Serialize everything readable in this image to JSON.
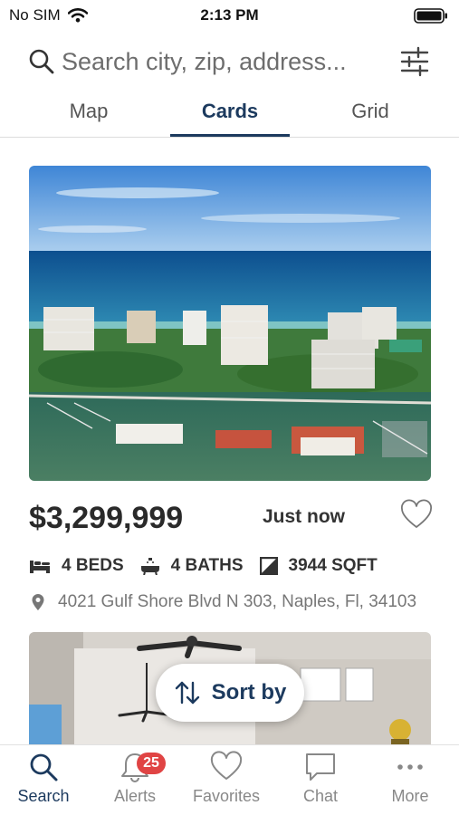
{
  "status_bar": {
    "carrier": "No SIM",
    "time": "2:13 PM"
  },
  "search": {
    "placeholder": "Search city, zip, address..."
  },
  "tabs": [
    {
      "label": "Map"
    },
    {
      "label": "Cards"
    },
    {
      "label": "Grid"
    }
  ],
  "listing": {
    "price": "$3,299,999",
    "posted": "Just now",
    "beds": "4 BEDS",
    "baths": "4 BATHS",
    "sqft": "3944 SQFT",
    "address": "4021 Gulf Shore Blvd N 303, Naples, Fl, 34103"
  },
  "sort": {
    "label": "Sort by"
  },
  "bottom_nav": {
    "items": [
      {
        "label": "Search",
        "icon": "search-icon"
      },
      {
        "label": "Alerts",
        "icon": "bell-icon",
        "badge": "25"
      },
      {
        "label": "Favorites",
        "icon": "heart-icon"
      },
      {
        "label": "Chat",
        "icon": "chat-bubble-icon"
      },
      {
        "label": "More",
        "icon": "more-dots-icon"
      }
    ]
  },
  "colors": {
    "accent": "#1c3a5e",
    "badge": "#e04444",
    "muted": "#888888"
  }
}
